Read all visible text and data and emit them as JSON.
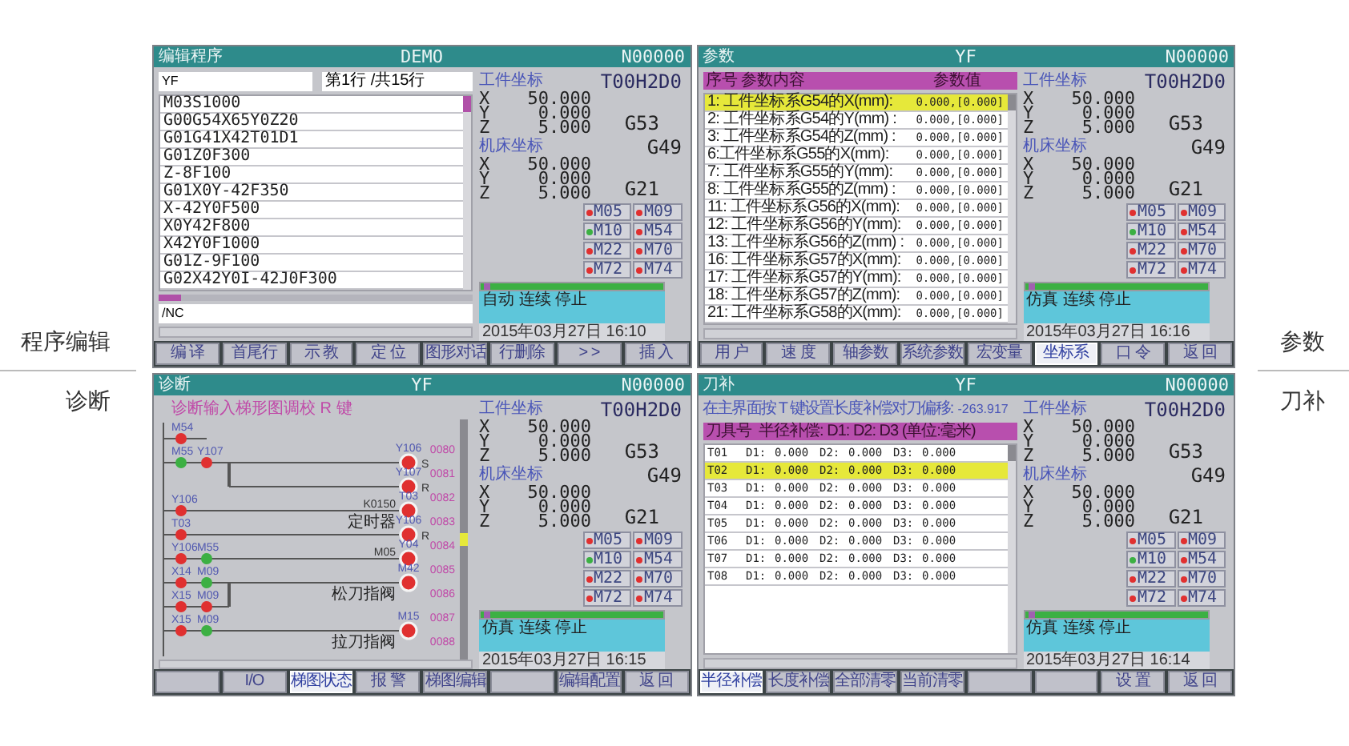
{
  "side_labels": {
    "left": [
      "程序编辑",
      "诊断"
    ],
    "right": [
      "参数",
      "刀补"
    ]
  },
  "panels": [
    {
      "kind": "program",
      "title": "编辑程序",
      "name": "DEMO",
      "number": "N00000",
      "program": {
        "file": "YF",
        "position": "第1行 /共15行",
        "lines": [
          "M03S1000",
          "G00G54X65Y0Z20",
          "G01G41X42T01D1",
          "G01Z0F300",
          "Z-8F100",
          "G01X0Y-42F350",
          "X-42Y0F500",
          "X0Y42F800",
          "X42Y0F1000",
          "G01Z-9F100",
          "G02X42Y0I-42J0F300"
        ],
        "path": "/NC"
      },
      "status": {
        "tool": "T00H2D0",
        "work_label": "工件坐标",
        "work": [
          {
            "axis": "X",
            "value": "50.000"
          },
          {
            "axis": "Y",
            "value": "0.000"
          },
          {
            "axis": "Z",
            "value": "5.000"
          }
        ],
        "g_code_1": "G53",
        "machine_label": "机床坐标",
        "g_code_2": "G49",
        "machine": [
          {
            "axis": "X",
            "value": "50.000"
          },
          {
            "axis": "Y",
            "value": "0.000"
          },
          {
            "axis": "Z",
            "value": "5.000"
          }
        ],
        "g_code_3": "G21",
        "m_codes": [
          {
            "label": "M05",
            "color": "#e03030"
          },
          {
            "label": "M09",
            "color": "#e03030"
          },
          {
            "label": "M10",
            "color": "#3cb043"
          },
          {
            "label": "M54",
            "color": "#e03030"
          },
          {
            "label": "M22",
            "color": "#e03030"
          },
          {
            "label": "M70",
            "color": "#e03030"
          },
          {
            "label": "M72",
            "color": "#e03030"
          },
          {
            "label": "M74",
            "color": "#e03030"
          }
        ],
        "mode": "自动 连续 停止",
        "datetime": "2015年03月27日 16:10"
      },
      "softkeys": [
        {
          "label": "编 译",
          "selected": false
        },
        {
          "label": "首尾行",
          "selected": false
        },
        {
          "label": "示 教",
          "selected": false
        },
        {
          "label": "定 位",
          "selected": false
        },
        {
          "label": "图形对话",
          "selected": false
        },
        {
          "label": "行删除",
          "selected": false
        },
        {
          "label": "> >",
          "selected": false
        },
        {
          "label": "插 入",
          "selected": false
        }
      ]
    },
    {
      "kind": "parameters",
      "title": "参数",
      "name": "YF",
      "number": "N00000",
      "parameters": {
        "columns": [
          "序号",
          "参数内容",
          "参数值"
        ],
        "rows": [
          {
            "label": "1: 工件坐标系G54的X(mm):",
            "value": "0.000,[0.000]",
            "selected": true
          },
          {
            "label": "2: 工件坐标系G54的Y(mm) :",
            "value": "0.000,[0.000]",
            "selected": false
          },
          {
            "label": "3: 工件坐标系G54的Z(mm) :",
            "value": "0.000,[0.000]",
            "selected": false
          },
          {
            "label": "6:工件坐标系G55的X(mm):",
            "value": "0.000,[0.000]",
            "selected": false
          },
          {
            "label": "7: 工件坐标系G55的Y(mm):",
            "value": "0.000,[0.000]",
            "selected": false
          },
          {
            "label": "8: 工件坐标系G55的Z(mm) :",
            "value": "0.000,[0.000]",
            "selected": false
          },
          {
            "label": "11: 工件坐标系G56的X(mm):",
            "value": "0.000,[0.000]",
            "selected": false
          },
          {
            "label": "12: 工件坐标系G56的Y(mm):",
            "value": "0.000,[0.000]",
            "selected": false
          },
          {
            "label": "13: 工件坐标系G56的Z(mm) :",
            "value": "0.000,[0.000]",
            "selected": false
          },
          {
            "label": "16: 工件坐标系G57的X(mm):",
            "value": "0.000,[0.000]",
            "selected": false
          },
          {
            "label": "17: 工件坐标系G57的Y(mm):",
            "value": "0.000,[0.000]",
            "selected": false
          },
          {
            "label": "18: 工件坐标系G57的Z(mm):",
            "value": "0.000,[0.000]",
            "selected": false
          },
          {
            "label": "21: 工件坐标系G58的X(mm):",
            "value": "0.000,[0.000]",
            "selected": false
          }
        ]
      },
      "status": {
        "tool": "T00H2D0",
        "work_label": "工件坐标",
        "work": [
          {
            "axis": "X",
            "value": "50.000"
          },
          {
            "axis": "Y",
            "value": "0.000"
          },
          {
            "axis": "Z",
            "value": "5.000"
          }
        ],
        "g_code_1": "G53",
        "machine_label": "机床坐标",
        "g_code_2": "G49",
        "machine": [
          {
            "axis": "X",
            "value": "50.000"
          },
          {
            "axis": "Y",
            "value": "0.000"
          },
          {
            "axis": "Z",
            "value": "5.000"
          }
        ],
        "g_code_3": "G21",
        "m_codes": [
          {
            "label": "M05",
            "color": "#e03030"
          },
          {
            "label": "M09",
            "color": "#e03030"
          },
          {
            "label": "M10",
            "color": "#3cb043"
          },
          {
            "label": "M54",
            "color": "#e03030"
          },
          {
            "label": "M22",
            "color": "#e03030"
          },
          {
            "label": "M70",
            "color": "#e03030"
          },
          {
            "label": "M72",
            "color": "#e03030"
          },
          {
            "label": "M74",
            "color": "#e03030"
          }
        ],
        "mode": "仿真 连续 停止",
        "datetime": "2015年03月27日 16:16"
      },
      "softkeys": [
        {
          "label": "用 户",
          "selected": false
        },
        {
          "label": "速 度",
          "selected": false
        },
        {
          "label": "轴参数",
          "selected": false
        },
        {
          "label": "系统参数",
          "selected": false
        },
        {
          "label": "宏变量",
          "selected": false
        },
        {
          "label": "坐标系",
          "selected": true
        },
        {
          "label": "口 令",
          "selected": false
        },
        {
          "label": "返 回",
          "selected": false
        }
      ]
    },
    {
      "kind": "ladder",
      "title": "诊断",
      "name": "YF",
      "number": "N00000",
      "ladder": {
        "note": "诊断输入梯形图调校 R 键",
        "rows": [
          {
            "contacts": [
              {
                "label": "M54",
                "color": "#e03030"
              }
            ],
            "line": "0080"
          },
          {
            "contacts": [
              {
                "label": "M55",
                "color": "#3cb043"
              },
              {
                "label": "Y107",
                "color": "#e03030"
              }
            ],
            "coil": {
              "label": "Y106",
              "side": "S"
            },
            "line": "0081"
          },
          {
            "branch": true,
            "coil": {
              "label": "Y107",
              "side": "R"
            },
            "line": "0082"
          },
          {
            "contacts": [
              {
                "label": "Y106",
                "color": "#e03030"
              }
            ],
            "coil": {
              "label": "T03",
              "preset": "K0150",
              "note": "定时器"
            },
            "line": "0083"
          },
          {
            "contacts": [
              {
                "label": "T03",
                "color": "#e03030"
              }
            ],
            "coil": {
              "label": "Y106",
              "side": "R"
            },
            "line": "0084"
          },
          {
            "contacts": [
              {
                "label": "Y106",
                "color": "#e03030"
              },
              {
                "label": "M55",
                "color": "#3cb043"
              }
            ],
            "coil": {
              "label": "Y04",
              "preset": "M05"
            },
            "line": "0085"
          },
          {
            "contacts": [
              {
                "label": "X14",
                "color": "#e03030"
              },
              {
                "label": "M09",
                "color": "#3cb043"
              }
            ],
            "coil": {
              "label": "M42",
              "note": "松刀指阀"
            },
            "line": "0086"
          },
          {
            "branch": true,
            "contacts": [
              {
                "label": "X15",
                "color": "#e03030"
              },
              {
                "label": "M09",
                "color": "#e03030"
              }
            ],
            "line": "0087"
          },
          {
            "contacts": [
              {
                "label": "X15",
                "color": "#e03030"
              },
              {
                "label": "M09",
                "color": "#3cb043"
              }
            ],
            "coil": {
              "label": "M15",
              "note": "拉刀指阀"
            },
            "line": "0088"
          }
        ]
      },
      "status": {
        "tool": "T00H2D0",
        "work_label": "工件坐标",
        "work": [
          {
            "axis": "X",
            "value": "50.000"
          },
          {
            "axis": "Y",
            "value": "0.000"
          },
          {
            "axis": "Z",
            "value": "5.000"
          }
        ],
        "g_code_1": "G53",
        "machine_label": "机床坐标",
        "g_code_2": "G49",
        "machine": [
          {
            "axis": "X",
            "value": "50.000"
          },
          {
            "axis": "Y",
            "value": "0.000"
          },
          {
            "axis": "Z",
            "value": "5.000"
          }
        ],
        "g_code_3": "G21",
        "m_codes": [
          {
            "label": "M05",
            "color": "#e03030"
          },
          {
            "label": "M09",
            "color": "#e03030"
          },
          {
            "label": "M10",
            "color": "#3cb043"
          },
          {
            "label": "M54",
            "color": "#e03030"
          },
          {
            "label": "M22",
            "color": "#e03030"
          },
          {
            "label": "M70",
            "color": "#e03030"
          },
          {
            "label": "M72",
            "color": "#e03030"
          },
          {
            "label": "M74",
            "color": "#e03030"
          }
        ],
        "mode": "仿真 连续 停止",
        "datetime": "2015年03月27日 16:15"
      },
      "softkeys": [
        {
          "selected": false
        },
        {
          "label": "I/O",
          "selected": false
        },
        {
          "label": "梯图状态",
          "selected": true
        },
        {
          "label": "报 警",
          "selected": false
        },
        {
          "label": "梯图编辑",
          "selected": false
        },
        {
          "selected": false
        },
        {
          "label": "编辑配置",
          "selected": false
        },
        {
          "label": "返 回",
          "selected": false
        }
      ]
    },
    {
      "kind": "tool_offset",
      "title": "刀补",
      "name": "YF",
      "number": "N00000",
      "offsets": {
        "note": "在主界面按 T 键设置长度补偿对刀偏移:",
        "note_value": "-263.917",
        "header": "刀具号  半径补偿: D1: D2: D3 (单位:毫米)",
        "rows": [
          {
            "cells": [
              "T01",
              "D1:",
              "0.000",
              "D2:",
              "0.000",
              "D3:",
              "0.000"
            ],
            "selected": false
          },
          {
            "cells": [
              "T02",
              "D1:",
              "0.000",
              "D2:",
              "0.000",
              "D3:",
              "0.000"
            ],
            "selected": true
          },
          {
            "cells": [
              "T03",
              "D1:",
              "0.000",
              "D2:",
              "0.000",
              "D3:",
              "0.000"
            ],
            "selected": false
          },
          {
            "cells": [
              "T04",
              "D1:",
              "0.000",
              "D2:",
              "0.000",
              "D3:",
              "0.000"
            ],
            "selected": false
          },
          {
            "cells": [
              "T05",
              "D1:",
              "0.000",
              "D2:",
              "0.000",
              "D3:",
              "0.000"
            ],
            "selected": false
          },
          {
            "cells": [
              "T06",
              "D1:",
              "0.000",
              "D2:",
              "0.000",
              "D3:",
              "0.000"
            ],
            "selected": false
          },
          {
            "cells": [
              "T07",
              "D1:",
              "0.000",
              "D2:",
              "0.000",
              "D3:",
              "0.000"
            ],
            "selected": false
          },
          {
            "cells": [
              "T08",
              "D1:",
              "0.000",
              "D2:",
              "0.000",
              "D3:",
              "0.000"
            ],
            "selected": false
          }
        ]
      },
      "status": {
        "tool": "T00H2D0",
        "work_label": "工件坐标",
        "work": [
          {
            "axis": "X",
            "value": "50.000"
          },
          {
            "axis": "Y",
            "value": "0.000"
          },
          {
            "axis": "Z",
            "value": "5.000"
          }
        ],
        "g_code_1": "G53",
        "machine_label": "机床坐标",
        "g_code_2": "G49",
        "machine": [
          {
            "axis": "X",
            "value": "50.000"
          },
          {
            "axis": "Y",
            "value": "0.000"
          },
          {
            "axis": "Z",
            "value": "5.000"
          }
        ],
        "g_code_3": "G21",
        "m_codes": [
          {
            "label": "M05",
            "color": "#e03030"
          },
          {
            "label": "M09",
            "color": "#e03030"
          },
          {
            "label": "M10",
            "color": "#3cb043"
          },
          {
            "label": "M54",
            "color": "#e03030"
          },
          {
            "label": "M22",
            "color": "#e03030"
          },
          {
            "label": "M70",
            "color": "#e03030"
          },
          {
            "label": "M72",
            "color": "#e03030"
          },
          {
            "label": "M74",
            "color": "#e03030"
          }
        ],
        "mode": "仿真 连续 停止",
        "datetime": "2015年03月27日 16:14"
      },
      "softkeys": [
        {
          "label": "半径补偿",
          "selected": true
        },
        {
          "label": "长度补偿",
          "selected": false
        },
        {
          "label": "全部清零",
          "selected": false
        },
        {
          "label": "当前清零",
          "selected": false
        },
        {
          "selected": false
        },
        {
          "selected": false
        },
        {
          "label": "设 置",
          "selected": false
        },
        {
          "label": "返 回",
          "selected": false
        }
      ]
    }
  ]
}
